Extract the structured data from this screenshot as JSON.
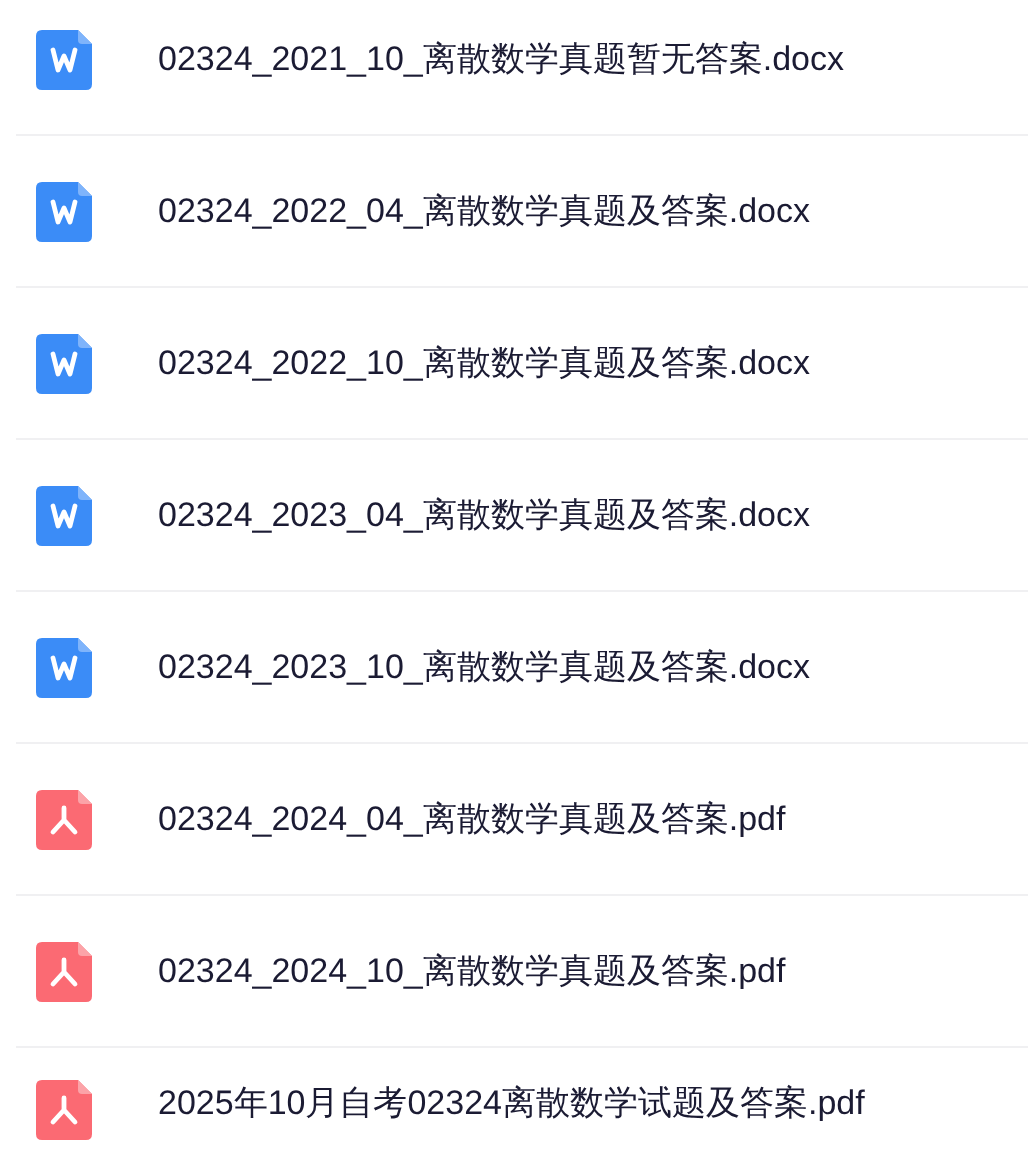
{
  "files": [
    {
      "kind": "docx",
      "name": "02324_2021_10_离散数学真题暂无答案.docx"
    },
    {
      "kind": "docx",
      "name": "02324_2022_04_离散数学真题及答案.docx"
    },
    {
      "kind": "docx",
      "name": "02324_2022_10_离散数学真题及答案.docx"
    },
    {
      "kind": "docx",
      "name": "02324_2023_04_离散数学真题及答案.docx"
    },
    {
      "kind": "docx",
      "name": "02324_2023_10_离散数学真题及答案.docx"
    },
    {
      "kind": "pdf",
      "name": "02324_2024_04_离散数学真题及答案.pdf"
    },
    {
      "kind": "pdf",
      "name": "02324_2024_10_离散数学真题及答案.pdf"
    },
    {
      "kind": "pdf",
      "name": "2025年10月自考02324离散数学试题及答案.pdf"
    }
  ]
}
